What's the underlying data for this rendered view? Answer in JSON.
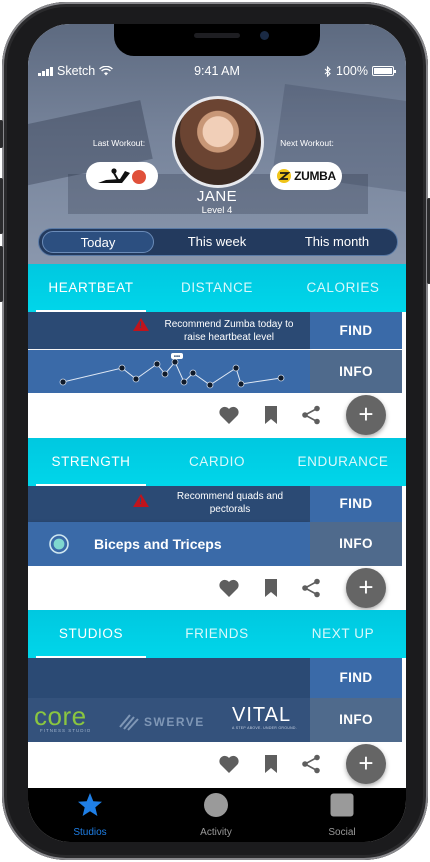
{
  "status": {
    "carrier": "Sketch",
    "time": "9:41 AM",
    "battery": "100%"
  },
  "profile": {
    "last_workout_label": "Last Workout:",
    "next_workout_label": "Next Workout:",
    "next_workout_logo": "ZUMBA",
    "name": "JANE",
    "level": "Level 4"
  },
  "range": {
    "options": [
      "Today",
      "This week",
      "This month"
    ],
    "selected": "Today"
  },
  "heartbeat_card": {
    "tabs": [
      "HEARTBEAT",
      "DISTANCE",
      "CALORIES"
    ],
    "active_tab": "HEARTBEAT",
    "note_line1": "Recommend Zumba today to",
    "note_line2": "raise heartbeat level",
    "find": "FIND",
    "info": "INFO",
    "sparkline_marker": "•••"
  },
  "strength_card": {
    "tabs": [
      "STRENGTH",
      "CARDIO",
      "ENDURANCE"
    ],
    "active_tab": "STRENGTH",
    "note_line1": "Recommend quads and",
    "note_line2": "pectorals",
    "item": "Biceps and Triceps",
    "find": "FIND",
    "info": "INFO"
  },
  "studios_card": {
    "tabs": [
      "STUDIOS",
      "FRIENDS",
      "NEXT UP"
    ],
    "active_tab": "STUDIOS",
    "find": "FIND",
    "info": "INFO",
    "logos": {
      "core": "core",
      "core_sub": "FITNESS STUDIO",
      "swerve": "SWERVE",
      "vital": "VITAL",
      "vital_sub": "A STEP ABOVE. UNDER GROUND."
    }
  },
  "card_actions": {
    "add": "+"
  },
  "tabbar": [
    {
      "label": "Studios",
      "icon": "star-icon",
      "active": true
    },
    {
      "label": "Activity",
      "icon": "circle-icon",
      "active": false
    },
    {
      "label": "Social",
      "icon": "square-icon",
      "active": false
    }
  ],
  "colors": {
    "accent": "#00d0e6",
    "navy": "#2b4a74",
    "active_tab": "#1f7fe6",
    "warning": "#c0141c"
  }
}
